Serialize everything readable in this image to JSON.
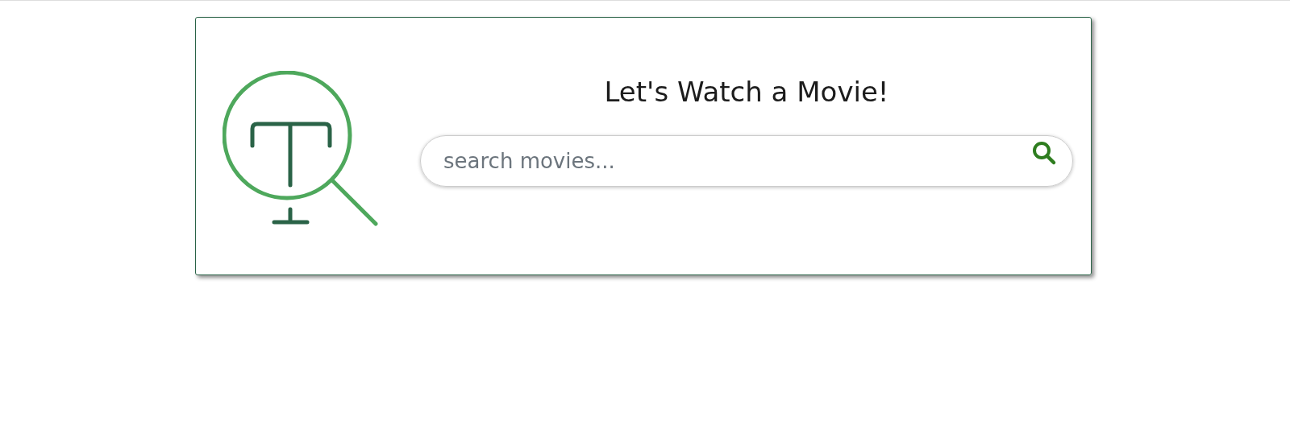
{
  "card": {
    "title": "Let's Watch a Movie!",
    "search": {
      "placeholder": "search movies..."
    }
  }
}
